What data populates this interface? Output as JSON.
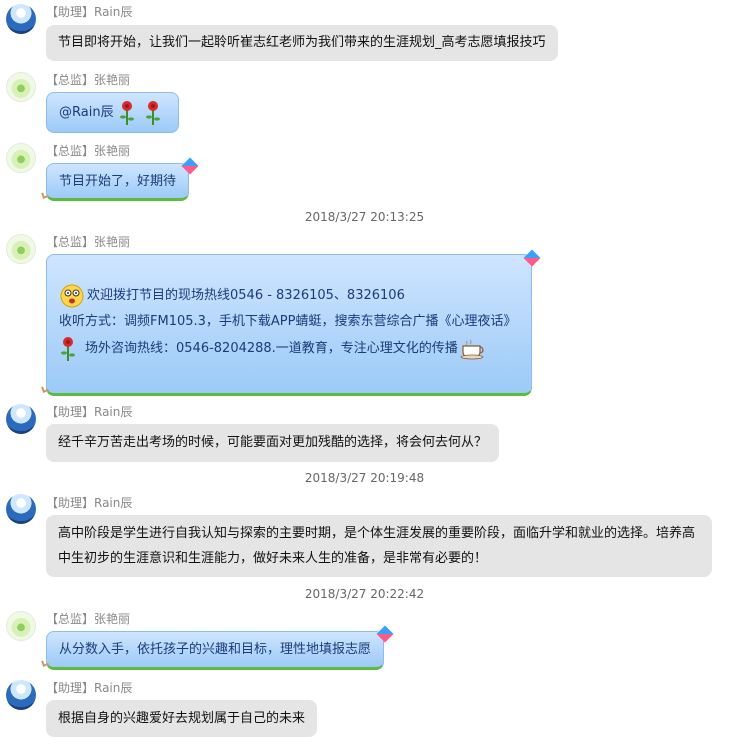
{
  "messages": [
    {
      "sender": "【助理】Rain辰",
      "text": "节目即将开始，让我们一起聆听崔志红老师为我们带来的生涯规划_高考志愿填报技巧"
    },
    {
      "sender": "【总监】张艳丽",
      "text": "@Rain辰"
    },
    {
      "sender": "【总监】张艳丽",
      "text": "节目开始了，好期待"
    },
    {
      "sender": "【总监】张艳丽",
      "line1": "欢迎拨打节目的现场热线0546 - 8326105、8326106",
      "line2": "收听方式：调频FM105.3，手机下载APP蜻蜓，搜索东营综合广播《心理夜话》",
      "line3": "场外咨询热线：0546-8204288.一道教育，专注心理文化的传播"
    },
    {
      "sender": "【助理】Rain辰",
      "text": "经千辛万苦走出考场的时候，可能要面对更加残酷的选择，将会何去何从？"
    },
    {
      "sender": "【助理】Rain辰",
      "line1": "高中阶段是学生进行自我认知与探索的主要时期，是个体生涯发展的重要阶段，面临升学和就业的选择。培养高",
      "line2": "中生初步的生涯意识和生涯能力，做好未来人生的准备，是非常有必要的！"
    },
    {
      "sender": "【总监】张艳丽",
      "text": "从分数入手，依托孩子的兴趣和目标，理性地填报志愿"
    },
    {
      "sender": "【助理】Rain辰",
      "text": "根据自身的兴趣爱好去规划属于自己的未来"
    }
  ],
  "timestamps": [
    "2018/3/27 20:13:25",
    "2018/3/27 20:19:48",
    "2018/3/27 20:22:42"
  ]
}
